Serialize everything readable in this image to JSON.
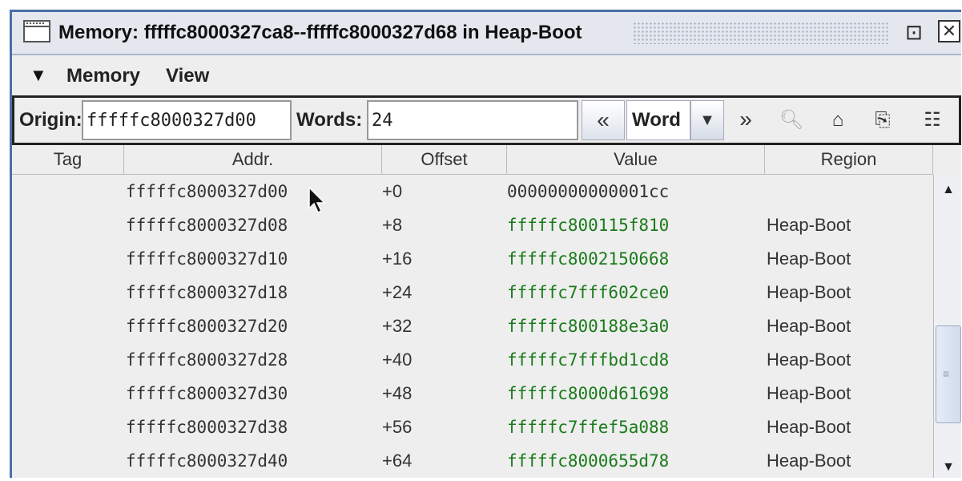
{
  "window": {
    "title": "Memory: fffffc8000327ca8--fffffc8000327d68 in Heap-Boot",
    "restore_glyph": "⊡",
    "close_glyph": "✕"
  },
  "menu": {
    "arrow": "▼",
    "items": [
      "Memory",
      "View"
    ]
  },
  "toolbar": {
    "origin_label": "Origin:",
    "origin_value": "fffffc8000327d00",
    "words_label": "Words:",
    "words_value": "24",
    "prev_glyph": "«",
    "unit": "Word",
    "dropdown_glyph": "▼",
    "next_glyph": "»",
    "icons": [
      "binoculars-icon",
      "home-icon",
      "copy-icon",
      "columns-icon"
    ]
  },
  "table": {
    "columns": [
      "Tag",
      "Addr.",
      "Offset",
      "Value",
      "Region"
    ],
    "rows": [
      {
        "tag": "",
        "addr": "fffffc8000327d00",
        "offset": "+0",
        "value": "00000000000001cc",
        "region": ""
      },
      {
        "tag": "",
        "addr": "fffffc8000327d08",
        "offset": "+8",
        "value": "fffffc800115f810",
        "region": "Heap-Boot"
      },
      {
        "tag": "",
        "addr": "fffffc8000327d10",
        "offset": "+16",
        "value": "fffffc8002150668",
        "region": "Heap-Boot"
      },
      {
        "tag": "",
        "addr": "fffffc8000327d18",
        "offset": "+24",
        "value": "fffffc7fff602ce0",
        "region": "Heap-Boot"
      },
      {
        "tag": "",
        "addr": "fffffc8000327d20",
        "offset": "+32",
        "value": "fffffc800188e3a0",
        "region": "Heap-Boot"
      },
      {
        "tag": "",
        "addr": "fffffc8000327d28",
        "offset": "+40",
        "value": "fffffc7fffbd1cd8",
        "region": "Heap-Boot"
      },
      {
        "tag": "",
        "addr": "fffffc8000327d30",
        "offset": "+48",
        "value": "fffffc8000d61698",
        "region": "Heap-Boot"
      },
      {
        "tag": "",
        "addr": "fffffc8000327d38",
        "offset": "+56",
        "value": "fffffc7ffef5a088",
        "region": "Heap-Boot"
      },
      {
        "tag": "",
        "addr": "fffffc8000327d40",
        "offset": "+64",
        "value": "fffffc8000655d78",
        "region": "Heap-Boot"
      }
    ]
  },
  "colors": {
    "pointer_value": "#1a7a1a",
    "window_border": "#4a6ea9"
  }
}
